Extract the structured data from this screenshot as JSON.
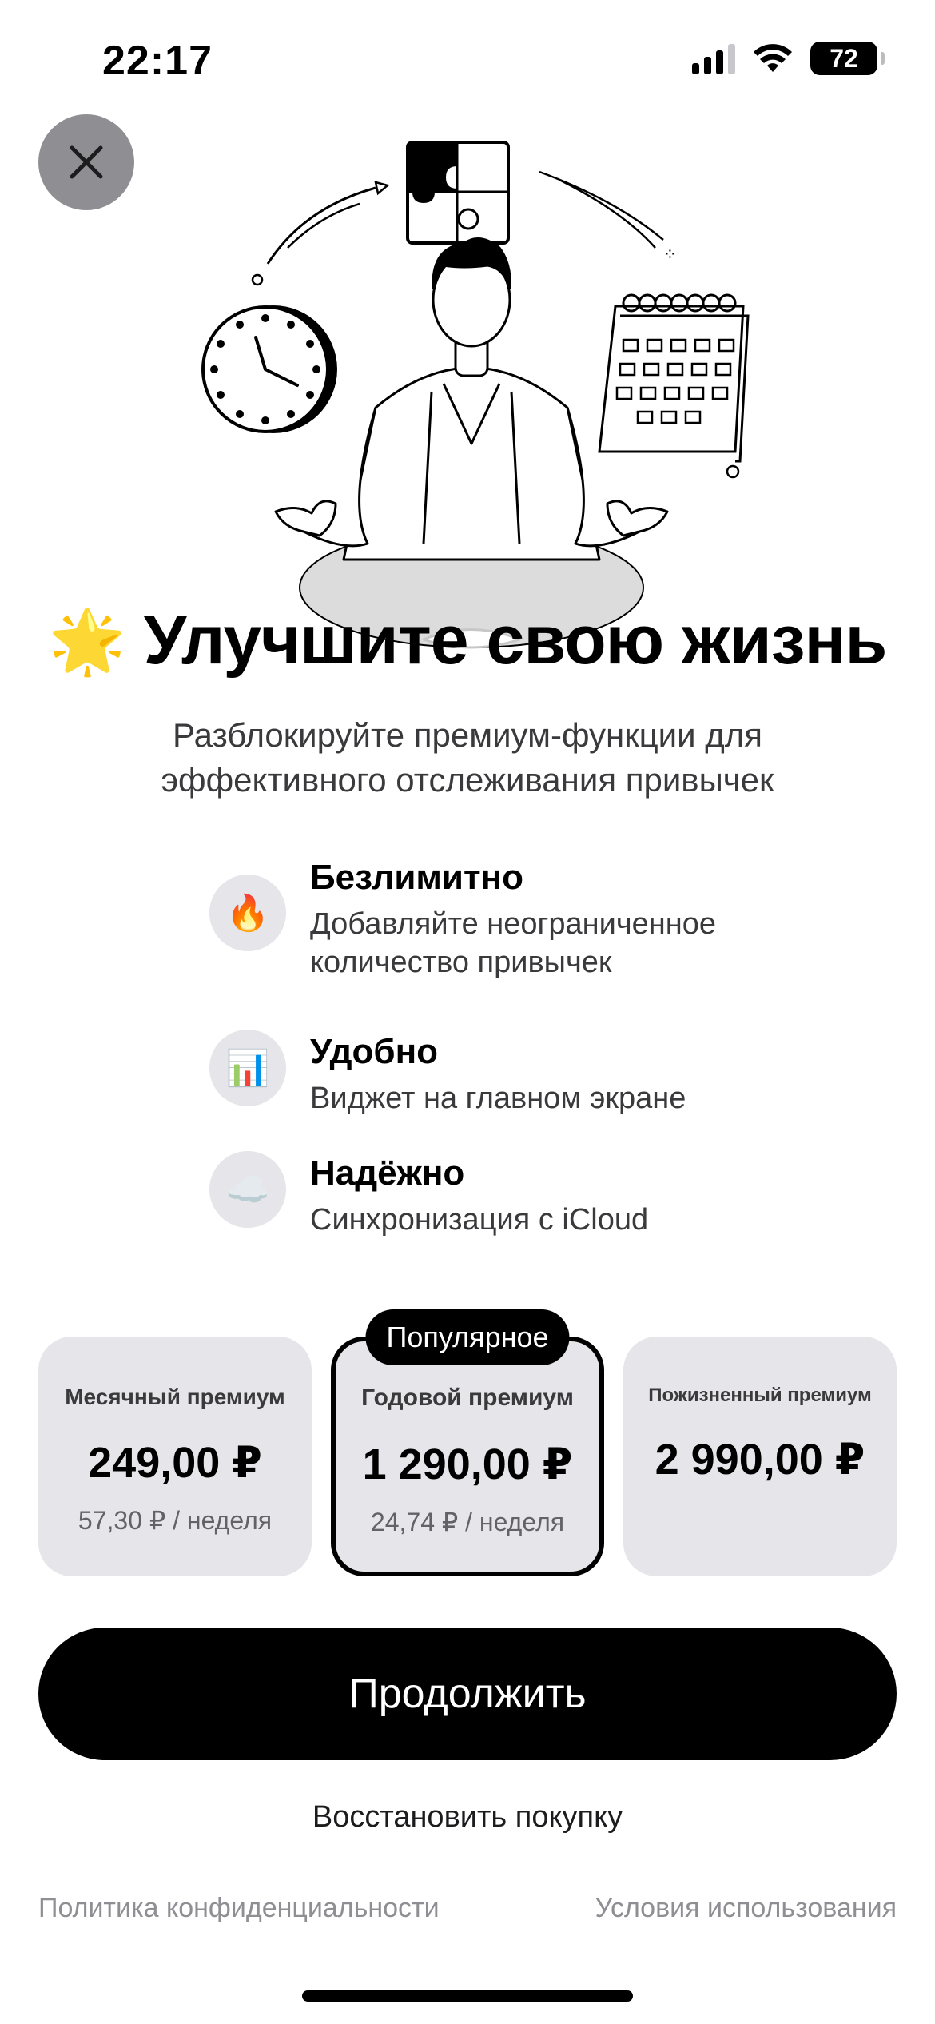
{
  "status_bar": {
    "time": "22:17",
    "battery": "72",
    "signal_icon": "cellular-signal-icon",
    "wifi_icon": "wifi-icon"
  },
  "close_icon": "close-icon",
  "hero": {
    "illustration": "meditating-person-with-clock-puzzle-calendar"
  },
  "header": {
    "emoji": "🌟",
    "title": "Улучшите свою жизнь",
    "subtitle": "Разблокируйте премиум-функции для эффективного отслеживания привычек"
  },
  "features": [
    {
      "icon": "🔥",
      "icon_name": "fire-icon",
      "title": "Безлимитно",
      "description": "Добавляйте неограниченное количество привычек"
    },
    {
      "icon": "📊",
      "icon_name": "chart-icon",
      "title": "Удобно",
      "description": "Виджет на главном экране"
    },
    {
      "icon": "☁️",
      "icon_name": "cloud-icon",
      "title": "Надёжно",
      "description": "Синхронизация с iCloud"
    }
  ],
  "plans": [
    {
      "name": "Месячный премиум",
      "price": "249,00 ₽",
      "per_week": "57,30 ₽ / неделя"
    },
    {
      "name": "Годовой премиум",
      "price": "1 290,00 ₽",
      "per_week": "24,74 ₽ / неделя",
      "badge": "Популярное",
      "selected": true
    },
    {
      "name": "Пожизненный премиум",
      "price": "2 990,00 ₽"
    }
  ],
  "actions": {
    "continue": "Продолжить",
    "restore": "Восстановить покупку"
  },
  "footer": {
    "privacy": "Политика конфиденциальности",
    "terms": "Условия использования"
  },
  "colors": {
    "accent": "#000000",
    "card_bg": "#e5e5ea",
    "muted_text": "#8e8e93"
  }
}
